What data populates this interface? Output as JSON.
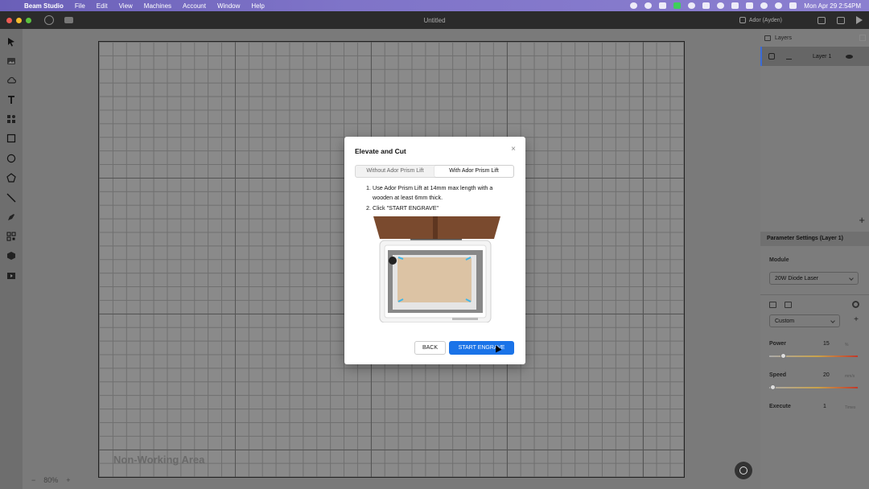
{
  "menubar": {
    "app_name": "Beam Studio",
    "items": [
      "File",
      "Edit",
      "View",
      "Machines",
      "Account",
      "Window",
      "Help"
    ],
    "datetime": "Mon Apr 29  2:54PM"
  },
  "window": {
    "title": "Untitled",
    "machine": "Ador (Ayden)"
  },
  "canvas": {
    "non_working_area": "Non-Working Area",
    "zoom": "80%",
    "zoom_minus": "−",
    "zoom_plus": "+"
  },
  "layers": {
    "header": "Layers",
    "items": [
      {
        "label": "Layer 1"
      }
    ],
    "add_button": "+"
  },
  "params": {
    "title": "Parameter Settings (Layer 1)",
    "module_label": "Module",
    "module_value": "20W Diode Laser",
    "preset_value": "Custom",
    "power_label": "Power",
    "power_value": "15",
    "power_unit": "%",
    "power_level": 0.15,
    "speed_label": "Speed",
    "speed_value": "20",
    "speed_unit": "mm/s",
    "speed_level": 0.04,
    "execute_label": "Execute",
    "execute_value": "1",
    "execute_unit": "Times"
  },
  "dialog": {
    "title": "Elevate and Cut",
    "close": "×",
    "tabs": [
      "Without Ador Prism Lift",
      "With Ador Prism Lift"
    ],
    "active_tab": 1,
    "steps": [
      {
        "num": "1.",
        "text": "Use Ador Prism Lift at 14mm max length with a wooden at least 6mm thick."
      },
      {
        "num": "2.",
        "text": "Click \"START ENGRAVE\""
      }
    ],
    "back_label": "BACK",
    "start_label": "START ENGRAVE"
  }
}
